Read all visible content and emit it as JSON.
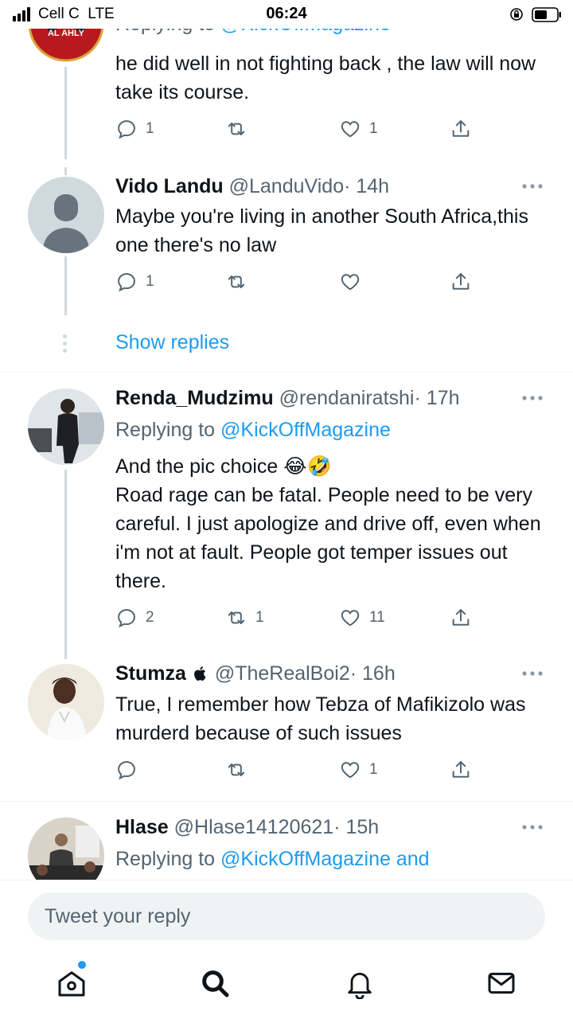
{
  "status_bar": {
    "carrier": "Cell C  LTE",
    "time": "06:24"
  },
  "tweets": [
    {
      "avatar": "al-ahly-crest-avatar",
      "avatar_text": "AL AHLY",
      "replying_prefix": "Replying to",
      "replying_mention": "@KickOffMagazine",
      "text": "he did well in not fighting back , the law will now take its course.",
      "reply_count": "1",
      "retweet_count": "",
      "like_count": "1"
    },
    {
      "name": "Vido Landu",
      "handle": "@LanduVido",
      "time": "· 14h",
      "avatar": "default-person-avatar",
      "text": "Maybe you're living in another South Africa,this one there's no law",
      "reply_count": "1",
      "retweet_count": "",
      "like_count": ""
    },
    {
      "name": "Renda_Mudzimu",
      "handle": "@rendaniratshi",
      "time": "· 17h",
      "avatar": "person-standing-photo-avatar",
      "replying_prefix": "Replying to",
      "replying_mention": "@KickOffMagazine",
      "text_line1": "And the pic choice 😂🤣",
      "text": "Road rage can be fatal. People need to be very careful. I just apologize and drive off, even when i'm not at fault. People got temper issues out there.",
      "reply_count": "2",
      "retweet_count": "1",
      "like_count": "11"
    },
    {
      "name": "Stumza",
      "handle": "@TheRealBoi2",
      "time": "· 16h",
      "avatar": "young-man-photo-avatar",
      "text": "True, I remember how Tebza of Mafikizolo was murderd because of such issues",
      "reply_count": "",
      "retweet_count": "",
      "like_count": "1"
    },
    {
      "name": "Hlase",
      "handle": "@Hlase14120621",
      "time": "· 15h",
      "avatar": "group-photo-avatar",
      "replying_prefix": "Replying to",
      "replying_mention": "@KickOffMagazine and"
    }
  ],
  "show_replies": "Show replies",
  "reply_bar": {
    "placeholder": "Tweet your reply"
  },
  "tab_bar": [
    "home-icon",
    "search-icon",
    "notifications-icon",
    "messages-icon"
  ],
  "colors": {
    "accent": "#1d9bf0",
    "secondary_text": "#536471",
    "thread_line": "#cfd9de"
  }
}
